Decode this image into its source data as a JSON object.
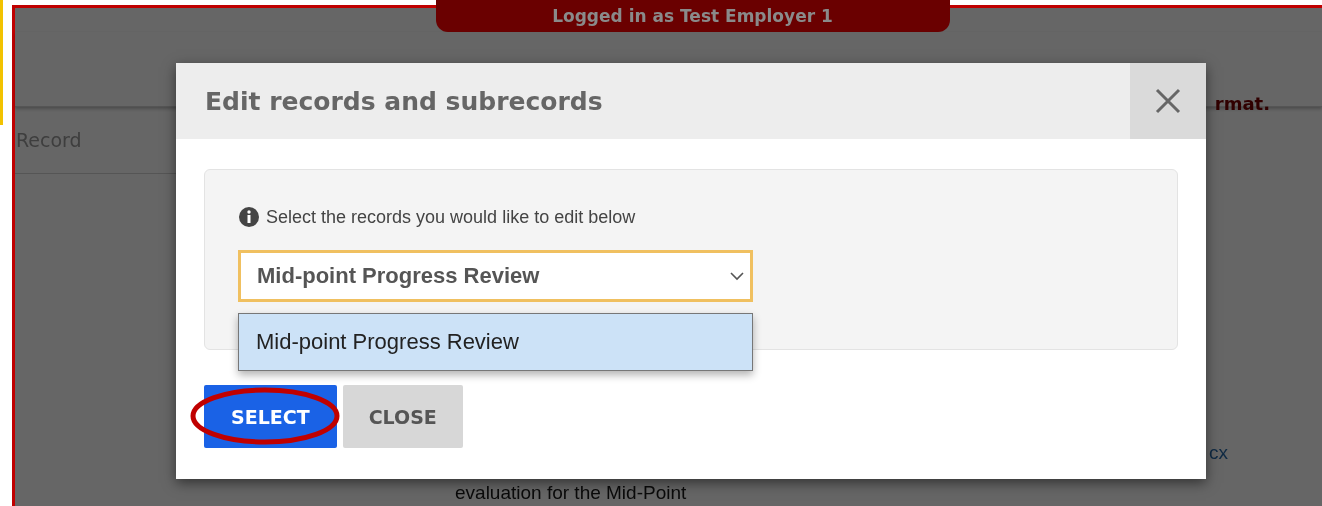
{
  "banner": {
    "text": "Logged in as Test Employer 1"
  },
  "background": {
    "left_label": "Record",
    "right_error": "rmat.",
    "link_fragment": "cx",
    "text_fragment": "evaluation for the Mid-Point"
  },
  "modal": {
    "title": "Edit records and subrecords",
    "info": "Select the records you would like to edit below",
    "select": {
      "value": "Mid-point Progress Review",
      "expanded": true
    },
    "options": [
      {
        "label": "Mid-point Progress Review",
        "selected": true
      }
    ],
    "buttons": [
      {
        "label": "SELECT",
        "kind": "primary",
        "highlighted": true
      },
      {
        "label": "CLOSE",
        "kind": "secondary",
        "highlighted": false
      }
    ]
  }
}
